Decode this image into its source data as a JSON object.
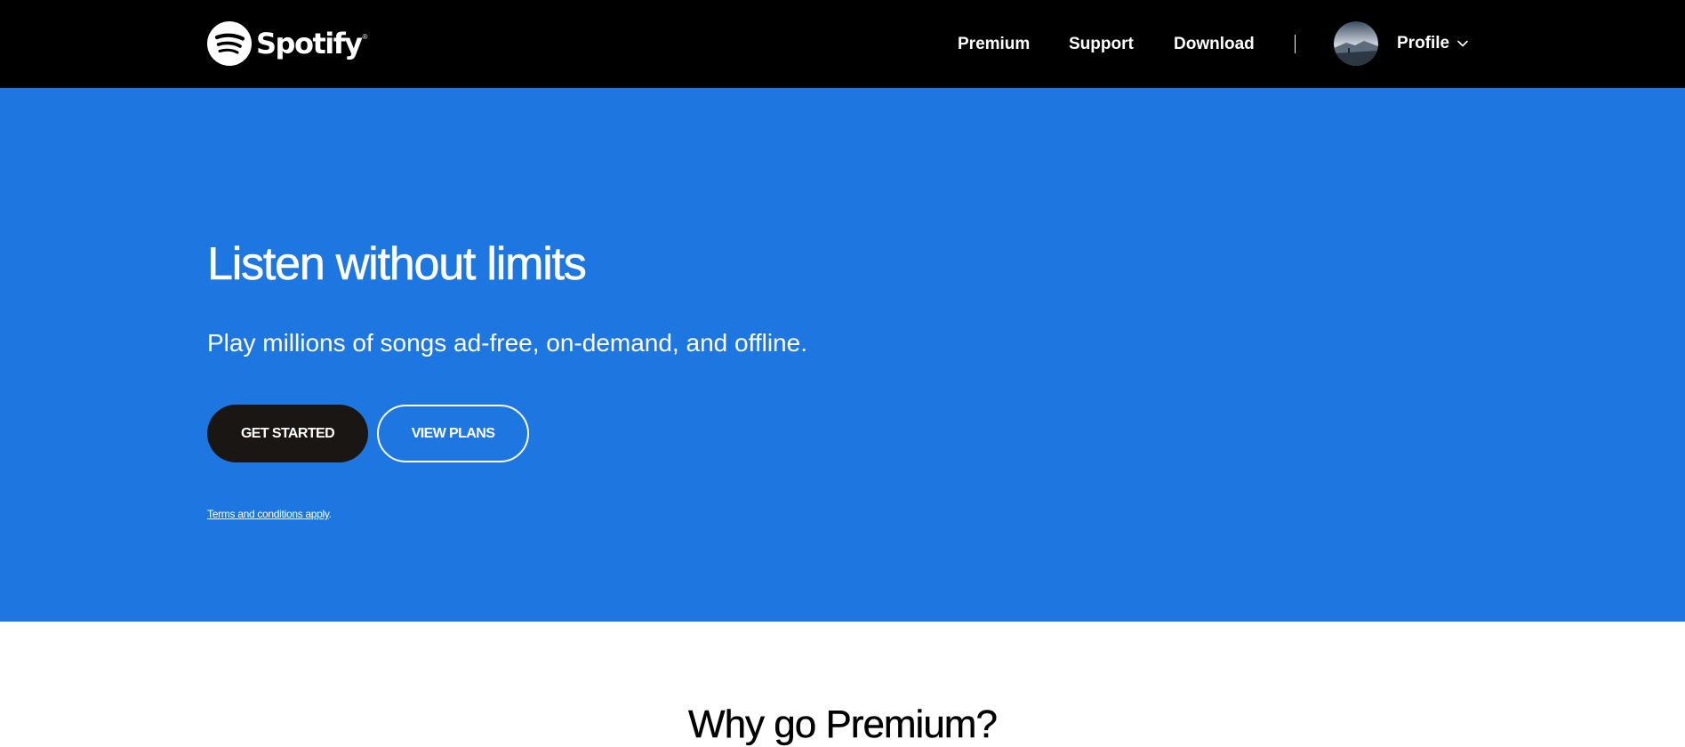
{
  "brand": {
    "name": "Spotify",
    "registered_mark": "®",
    "colors": {
      "header_bg": "#000000",
      "hero_bg": "#1e77e1",
      "primary_button_bg": "#1a1614",
      "text_light": "#ffffff"
    }
  },
  "nav": {
    "items": [
      {
        "label": "Premium"
      },
      {
        "label": "Support"
      },
      {
        "label": "Download"
      }
    ],
    "profile": {
      "label": "Profile",
      "avatar_icon": "avatar-photo",
      "dropdown_icon": "chevron-down-icon"
    }
  },
  "hero": {
    "title": "Listen without limits",
    "subtitle": "Play millions of songs ad-free, on-demand, and offline.",
    "primary_button": "GET STARTED",
    "secondary_button": "VIEW PLANS",
    "terms_link": "Terms and conditions apply",
    "terms_suffix": "."
  },
  "why": {
    "title": "Why go Premium?"
  }
}
